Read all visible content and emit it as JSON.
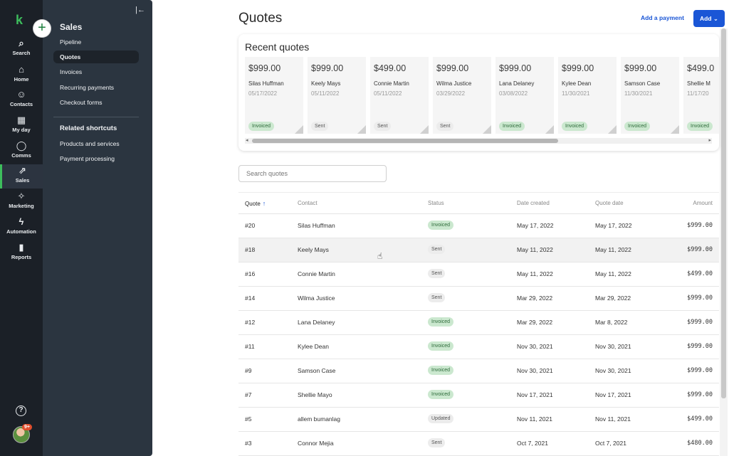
{
  "rail": {
    "logo": "k",
    "plus": "+",
    "items": [
      {
        "label": "Search",
        "icon": "⌕"
      },
      {
        "label": "Home",
        "icon": "⌂"
      },
      {
        "label": "Contacts",
        "icon": "☺"
      },
      {
        "label": "My day",
        "icon": "▦"
      },
      {
        "label": "Comms",
        "icon": "◯"
      },
      {
        "label": "Sales",
        "icon": "⇗"
      },
      {
        "label": "Marketing",
        "icon": "✧"
      },
      {
        "label": "Automation",
        "icon": "ϟ"
      },
      {
        "label": "Reports",
        "icon": "▮"
      }
    ],
    "help": "?",
    "badge": "9+"
  },
  "subnav": {
    "title": "Sales",
    "collapse": "|←",
    "links": [
      "Pipeline",
      "Quotes",
      "Invoices",
      "Recurring payments",
      "Checkout forms"
    ],
    "shortcuts_title": "Related shortcuts",
    "shortcuts": [
      "Products and services",
      "Payment processing"
    ]
  },
  "header": {
    "title": "Quotes",
    "add_payment": "Add a payment",
    "add": "Add ⌄"
  },
  "recent": {
    "title": "Recent quotes",
    "cards": [
      {
        "amount": "$999.00",
        "name": "Silas Huffman",
        "date": "05/17/2022",
        "status": "Invoiced"
      },
      {
        "amount": "$999.00",
        "name": "Keely Mays",
        "date": "05/11/2022",
        "status": "Sent"
      },
      {
        "amount": "$499.00",
        "name": "Connie Martin",
        "date": "05/11/2022",
        "status": "Sent"
      },
      {
        "amount": "$999.00",
        "name": "Wilma Justice",
        "date": "03/29/2022",
        "status": "Sent"
      },
      {
        "amount": "$999.00",
        "name": "Lana Delaney",
        "date": "03/08/2022",
        "status": "Invoiced"
      },
      {
        "amount": "$999.00",
        "name": "Kylee Dean",
        "date": "11/30/2021",
        "status": "Invoiced"
      },
      {
        "amount": "$999.00",
        "name": "Samson Case",
        "date": "11/30/2021",
        "status": "Invoiced"
      },
      {
        "amount": "$499.0",
        "name": "Shellie M",
        "date": "11/17/20",
        "status": "Invoiced"
      }
    ]
  },
  "search": {
    "placeholder": "Search quotes"
  },
  "table": {
    "headers": {
      "quote": "Quote",
      "sort_arrow": "↑",
      "contact": "Contact",
      "status": "Status",
      "created": "Date created",
      "qdate": "Quote date",
      "amount": "Amount"
    },
    "rows": [
      {
        "quote": "#20",
        "contact": "Silas Huffman",
        "status": "Invoiced",
        "created": "May 17, 2022",
        "qdate": "May 17, 2022",
        "amount": "$999.00"
      },
      {
        "quote": "#18",
        "contact": "Keely Mays",
        "status": "Sent",
        "created": "May 11, 2022",
        "qdate": "May 11, 2022",
        "amount": "$999.00"
      },
      {
        "quote": "#16",
        "contact": "Connie Martin",
        "status": "Sent",
        "created": "May 11, 2022",
        "qdate": "May 11, 2022",
        "amount": "$499.00"
      },
      {
        "quote": "#14",
        "contact": "Wilma Justice",
        "status": "Sent",
        "created": "Mar 29, 2022",
        "qdate": "Mar 29, 2022",
        "amount": "$999.00"
      },
      {
        "quote": "#12",
        "contact": "Lana Delaney",
        "status": "Invoiced",
        "created": "Mar 29, 2022",
        "qdate": "Mar 8, 2022",
        "amount": "$999.00"
      },
      {
        "quote": "#11",
        "contact": "Kylee Dean",
        "status": "Invoiced",
        "created": "Nov 30, 2021",
        "qdate": "Nov 30, 2021",
        "amount": "$999.00"
      },
      {
        "quote": "#9",
        "contact": "Samson Case",
        "status": "Invoiced",
        "created": "Nov 30, 2021",
        "qdate": "Nov 30, 2021",
        "amount": "$999.00"
      },
      {
        "quote": "#7",
        "contact": "Shellie Mayo",
        "status": "Invoiced",
        "created": "Nov 17, 2021",
        "qdate": "Nov 17, 2021",
        "amount": "$999.00"
      },
      {
        "quote": "#5",
        "contact": "allem bumanlag",
        "status": "Updated",
        "created": "Nov 11, 2021",
        "qdate": "Nov 11, 2021",
        "amount": "$499.00"
      },
      {
        "quote": "#3",
        "contact": "Connor Mejia",
        "status": "Sent",
        "created": "Oct 7, 2021",
        "qdate": "Oct 7, 2021",
        "amount": "$480.00"
      }
    ]
  },
  "colors": {
    "accent": "#1a56d6",
    "brand": "#3dbd5c",
    "invoiced": "#cbe8cf"
  }
}
